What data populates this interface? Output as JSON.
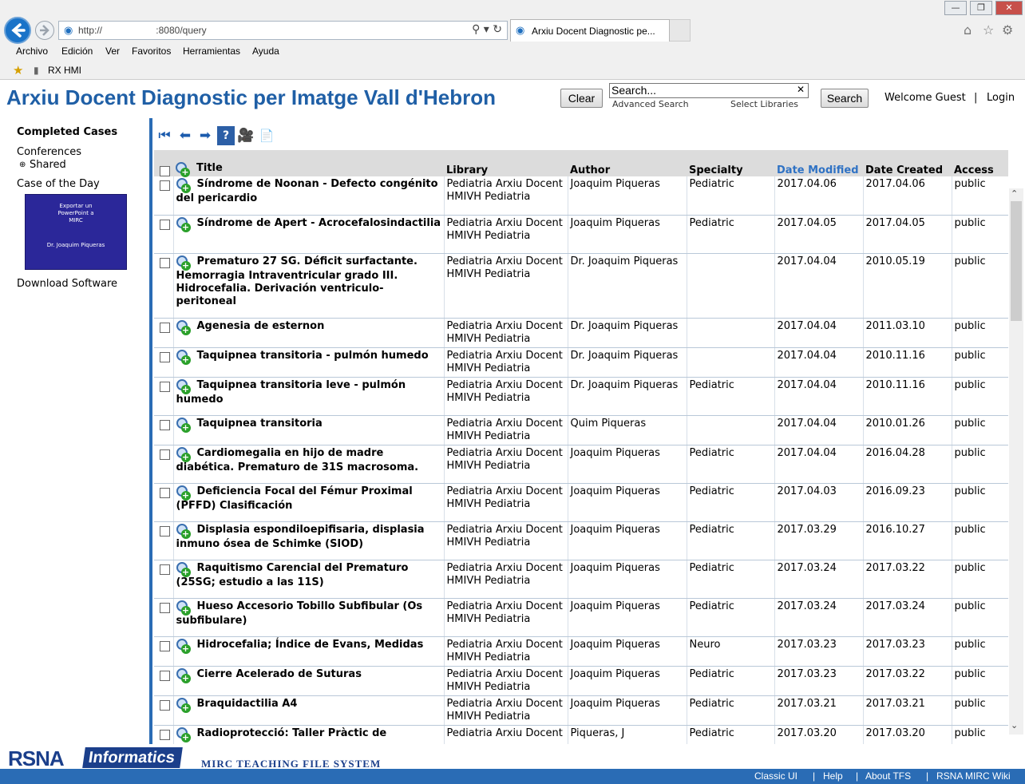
{
  "browser": {
    "address": "http://                            :8080/query",
    "tab_title": "Arxiu Docent Diagnostic pe...",
    "menu": [
      "Archivo",
      "Edición",
      "Ver",
      "Favoritos",
      "Herramientas",
      "Ayuda"
    ],
    "favorite": "RX HMI"
  },
  "header": {
    "title": "Arxiu Docent Diagnostic per Imatge Vall d'Hebron",
    "clear_label": "Clear",
    "search_value": "Search...",
    "advanced_search": "Advanced Search",
    "select_libraries": "Select Libraries",
    "search_label": "Search",
    "welcome": "Welcome Guest",
    "separator": "|",
    "login": "Login"
  },
  "sidebar": {
    "completed": "Completed Cases",
    "conferences": "Conferences",
    "shared": "Shared",
    "case_of_day": "Case of the Day",
    "promo_title": "Exportar un PowerPoint a MIRC",
    "promo_author": "Dr. Joaquim Piqueras",
    "download": "Download Software"
  },
  "columns": [
    "Title",
    "Library",
    "Author",
    "Specialty",
    "Date Modified",
    "Date Created",
    "Access"
  ],
  "rows": [
    {
      "title": "Síndrome de Noonan - Defecto congénito del pericardio",
      "library": "Pediatria Arxiu Docent HMIVH Pediatria",
      "author": "Joaquim Piqueras",
      "specialty": "Pediatric",
      "modified": "2017.04.06",
      "created": "2017.04.06",
      "access": "public"
    },
    {
      "title": "Síndrome de Apert - Acrocefalosindactilia",
      "library": "Pediatria Arxiu Docent HMIVH Pediatria",
      "author": "Joaquim Piqueras",
      "specialty": "Pediatric",
      "modified": "2017.04.05",
      "created": "2017.04.05",
      "access": "public"
    },
    {
      "title": "Prematuro 27 SG. Déficit surfactante. Hemorragia Intraventricular grado III. Hidrocefalia. Derivación ventriculo-peritoneal",
      "library": "Pediatria Arxiu Docent HMIVH Pediatria",
      "author": "Dr. Joaquim Piqueras",
      "specialty": "",
      "modified": "2017.04.04",
      "created": "2010.05.19",
      "access": "public"
    },
    {
      "title": "Agenesia de esternon",
      "library": "Pediatria Arxiu Docent HMIVH Pediatria",
      "author": "Dr. Joaquim Piqueras",
      "specialty": "",
      "modified": "2017.04.04",
      "created": "2011.03.10",
      "access": "public"
    },
    {
      "title": "Taquipnea transitoria - pulmón humedo",
      "library": "Pediatria Arxiu Docent HMIVH Pediatria",
      "author": "Dr. Joaquim Piqueras",
      "specialty": "",
      "modified": "2017.04.04",
      "created": "2010.11.16",
      "access": "public"
    },
    {
      "title": "Taquipnea transitoria leve - pulmón humedo",
      "library": "Pediatria Arxiu Docent HMIVH Pediatria",
      "author": "Dr. Joaquim Piqueras",
      "specialty": "Pediatric",
      "modified": "2017.04.04",
      "created": "2010.11.16",
      "access": "public"
    },
    {
      "title": "Taquipnea transitoria",
      "library": "Pediatria Arxiu Docent HMIVH Pediatria",
      "author": "Quim Piqueras",
      "specialty": "",
      "modified": "2017.04.04",
      "created": "2010.01.26",
      "access": "public"
    },
    {
      "title": "Cardiomegalia en hijo de madre diabética. Prematuro de 31S macrosoma.",
      "library": "Pediatria Arxiu Docent HMIVH Pediatria",
      "author": "Joaquim Piqueras",
      "specialty": "Pediatric",
      "modified": "2017.04.04",
      "created": "2016.04.28",
      "access": "public"
    },
    {
      "title": "Deficiencia Focal del Fémur Proximal (PFFD) Clasificación",
      "library": "Pediatria Arxiu Docent HMIVH Pediatria",
      "author": "Joaquim Piqueras",
      "specialty": "Pediatric",
      "modified": "2017.04.03",
      "created": "2016.09.23",
      "access": "public"
    },
    {
      "title": "Displasia espondiloepifisaria, displasia inmuno ósea de Schimke (SIOD)",
      "library": "Pediatria Arxiu Docent HMIVH Pediatria",
      "author": "Joaquim Piqueras",
      "specialty": "Pediatric",
      "modified": "2017.03.29",
      "created": "2016.10.27",
      "access": "public"
    },
    {
      "title": "Raquitismo Carencial del Prematuro (25SG; estudio a las 11S)",
      "library": "Pediatria Arxiu Docent HMIVH Pediatria",
      "author": "Joaquim Piqueras",
      "specialty": "Pediatric",
      "modified": "2017.03.24",
      "created": "2017.03.22",
      "access": "public"
    },
    {
      "title": "Hueso Accesorio Tobillo Subfibular (Os subfibulare)",
      "library": "Pediatria Arxiu Docent HMIVH Pediatria",
      "author": "Joaquim Piqueras",
      "specialty": "Pediatric",
      "modified": "2017.03.24",
      "created": "2017.03.24",
      "access": "public"
    },
    {
      "title": "Hidrocefalia; Índice de Evans, Medidas",
      "library": "Pediatria Arxiu Docent HMIVH Pediatria",
      "author": "Joaquim Piqueras",
      "specialty": "Neuro",
      "modified": "2017.03.23",
      "created": "2017.03.23",
      "access": "public"
    },
    {
      "title": "Cierre Acelerado de Suturas",
      "library": "Pediatria Arxiu Docent HMIVH Pediatria",
      "author": "Joaquim Piqueras",
      "specialty": "Pediatric",
      "modified": "2017.03.23",
      "created": "2017.03.22",
      "access": "public"
    },
    {
      "title": "Braquidactilia A4",
      "library": "Pediatria Arxiu Docent HMIVH Pediatria",
      "author": "Joaquim Piqueras",
      "specialty": "Pediatric",
      "modified": "2017.03.21",
      "created": "2017.03.21",
      "access": "public"
    },
    {
      "title": "Radioprotecció: Taller Pràctic de",
      "library": "Pediatria Arxiu Docent",
      "author": "Piqueras, J",
      "specialty": "Pediatric",
      "modified": "2017.03.20",
      "created": "2017.03.20",
      "access": "public"
    }
  ],
  "footer": {
    "brand": "RSNA",
    "brand_suffix": "Informatics",
    "tagline": "MIRC TEACHING FILE SYSTEM",
    "links": [
      "Classic UI",
      "Help",
      "About TFS",
      "RSNA MIRC Wiki"
    ],
    "sep": "|"
  },
  "colors": {
    "title_blue": "#1f5fa6",
    "sorted_header": "#2f72c4",
    "footer_bar": "#2a6cb5",
    "promo_bg": "#2b2799"
  }
}
